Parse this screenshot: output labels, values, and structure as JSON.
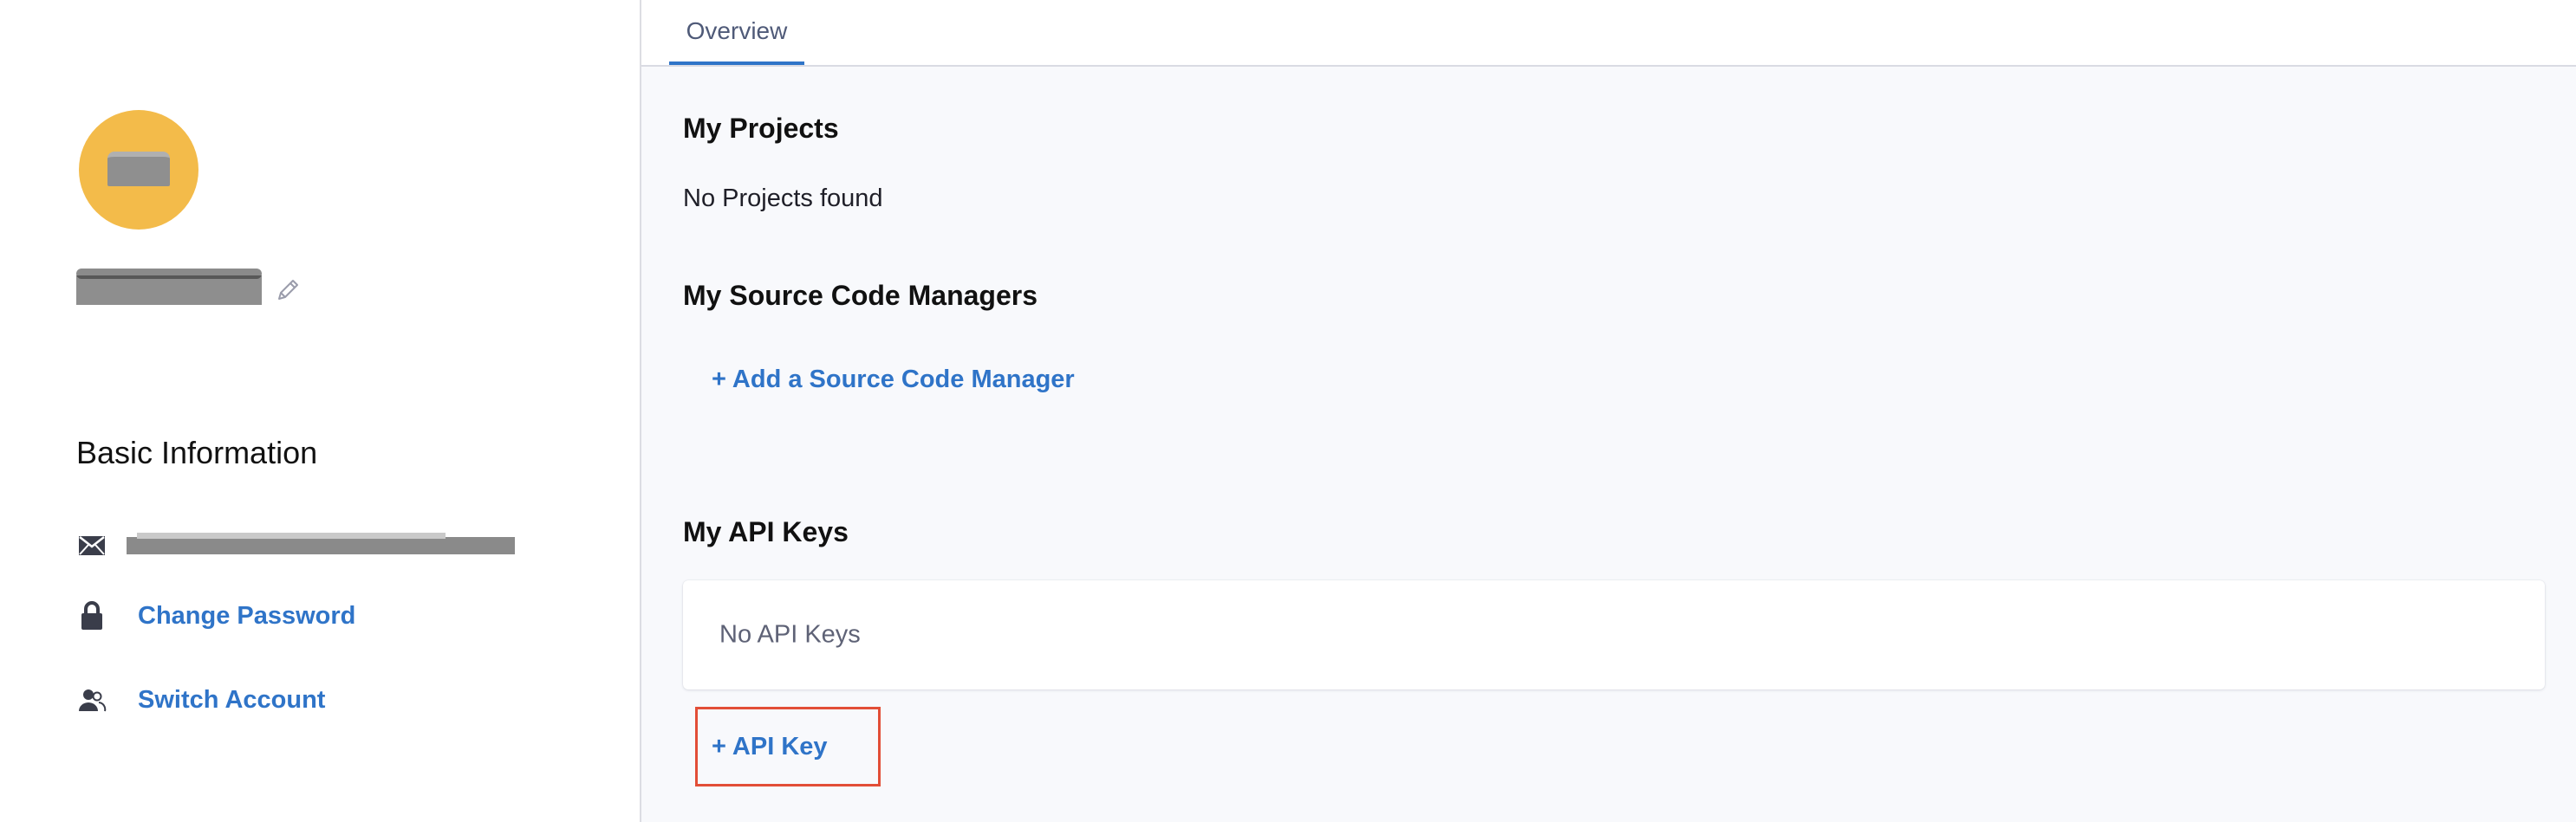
{
  "tabs": [
    {
      "label": "Overview",
      "active": true
    }
  ],
  "profile": {
    "avatar_color": "#f3bb4a",
    "name_redacted": true,
    "edit_icon": "pencil-icon"
  },
  "basic_information": {
    "title": "Basic Information",
    "email_icon": "envelope-icon",
    "email_redacted": true,
    "change_password": {
      "label": "Change Password",
      "icon": "lock-icon"
    },
    "switch_account": {
      "label": "Switch Account",
      "icon": "users-icon"
    }
  },
  "projects": {
    "title": "My Projects",
    "empty_text": "No Projects found"
  },
  "source_code_managers": {
    "title": "My Source Code Managers",
    "add_label": "+ Add a Source Code Manager"
  },
  "api_keys": {
    "title": "My API Keys",
    "empty_text": "No API Keys",
    "add_label": "+ API Key"
  },
  "colors": {
    "link": "#2f74c8",
    "highlight_border": "#e24e37",
    "tab_underline": "#2f74c8"
  }
}
